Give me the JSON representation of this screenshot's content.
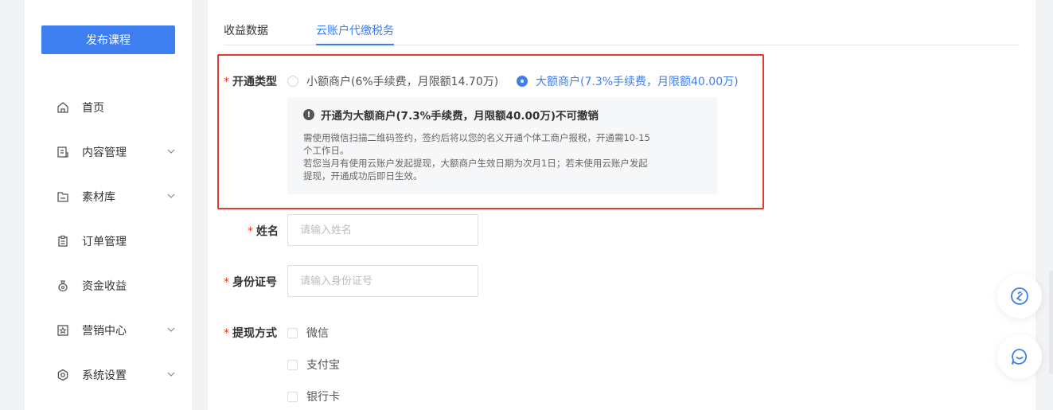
{
  "sidebar": {
    "publish_label": "发布课程",
    "items": [
      {
        "label": "首页",
        "icon": "home-icon",
        "has_chevron": false
      },
      {
        "label": "内容管理",
        "icon": "content-icon",
        "has_chevron": true
      },
      {
        "label": "素材库",
        "icon": "folder-icon",
        "has_chevron": true
      },
      {
        "label": "订单管理",
        "icon": "clipboard-icon",
        "has_chevron": false
      },
      {
        "label": "资金收益",
        "icon": "money-bag-icon",
        "has_chevron": false
      },
      {
        "label": "营销中心",
        "icon": "star-badge-icon",
        "has_chevron": true
      },
      {
        "label": "系统设置",
        "icon": "settings-icon",
        "has_chevron": true
      }
    ]
  },
  "tabs": [
    {
      "label": "收益数据",
      "active": false
    },
    {
      "label": "云账户代缴税务",
      "active": true
    }
  ],
  "form": {
    "type_label": "开通类型",
    "options": [
      {
        "label": "小额商户(6%手续费，月限额14.70万)",
        "checked": false
      },
      {
        "label": "大额商户(7.3%手续费，月限额40.00万)",
        "checked": true
      }
    ],
    "notice_title": "开通为大额商户(7.3%手续费，月限额40.00万)不可撤销",
    "notice_lines": [
      "需使用微信扫描二维码签约，签约后将以您的名义开通个体工商户报税，开通需10-15",
      "个工作日。",
      "若您当月有使用云账户发起提现，大额商户生效日期为次月1日；若未使用云账户发起",
      "提现，开通成功后即日生效。"
    ],
    "name_label": "姓名",
    "name_placeholder": "请输入姓名",
    "id_label": "身份证号",
    "id_placeholder": "请输入身份证号",
    "withdraw_label": "提现方式",
    "withdraw_options": [
      "微信",
      "支付宝",
      "银行卡"
    ],
    "required_mark": "*"
  },
  "colors": {
    "accent": "#3d7ef0",
    "highlight_border": "#e23a2e",
    "required": "#e23a2e"
  },
  "floating": [
    {
      "icon": "link-icon"
    },
    {
      "icon": "chat-icon"
    }
  ]
}
